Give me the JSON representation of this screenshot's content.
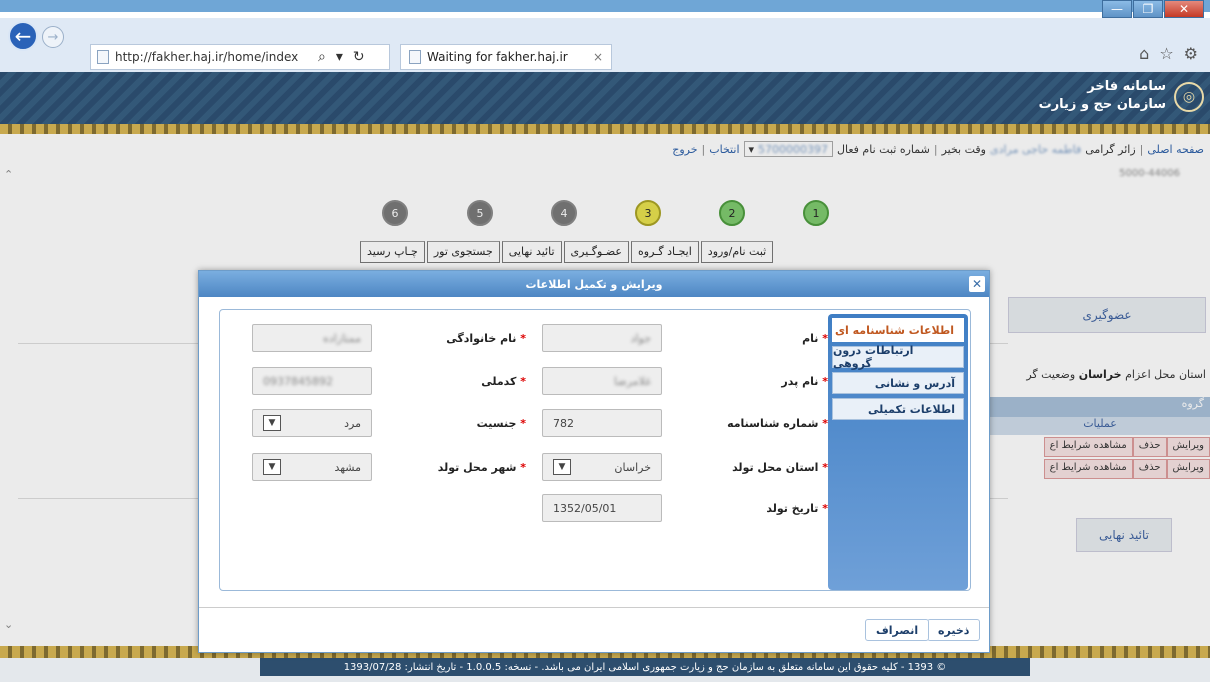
{
  "browser": {
    "url": "http://fakher.haj.ir/home/index",
    "tab_title": "Waiting for fakher.haj.ir",
    "win_min": "—",
    "win_max": "❐",
    "win_close": "✕"
  },
  "banner": {
    "brand_line1": "سامانه فاخر",
    "brand_line2": "سازمان حج و زیارت"
  },
  "userbar": {
    "home": "صفحه اصلی",
    "greeting_prefix": "زائر گرامی",
    "greeting_name": "فاطمه حاجی مرادی",
    "greeting_suffix": "وقت بخیر",
    "reg_label": "شماره ثبت نام فعال",
    "reg_number": "5700000397",
    "select": "انتخاب",
    "logout": "خروج",
    "subtitle": "5000-44006"
  },
  "steps": [
    {
      "num": "1",
      "label": "ثبت نام/ورود",
      "state": "done"
    },
    {
      "num": "2",
      "label": "ایجـاد گـروه",
      "state": "done"
    },
    {
      "num": "3",
      "label": "عضـوگـیری",
      "state": "current"
    },
    {
      "num": "4",
      "label": "تائید نهایی",
      "state": "pending"
    },
    {
      "num": "5",
      "label": "جستجوی تور",
      "state": "pending"
    },
    {
      "num": "6",
      "label": "چـاپ رسید",
      "state": "pending"
    }
  ],
  "right": {
    "membership_btn": "عضوگیری",
    "province_label": "استان محل اعزام",
    "province_value": "خراسان",
    "status_label": "وضعیت گر",
    "group_header": "گروه",
    "ops_header": "عملیات",
    "rows": [
      {
        "edit": "ویرایش",
        "delete": "حذف",
        "view": "مشاهده شرایط اع"
      },
      {
        "edit": "ویرایش",
        "delete": "حذف",
        "view": "مشاهده شرایط اع"
      }
    ],
    "final_btn": "تائید نهایی"
  },
  "modal": {
    "title": "ویرایش و تکمیل اطلاعات",
    "close": "✕",
    "tabs": [
      {
        "label": "اطلاعات شناسنامه ای",
        "active": true
      },
      {
        "label": "ارتباطات درون گروهی",
        "active": false
      },
      {
        "label": "آدرس و نشانی",
        "active": false
      },
      {
        "label": "اطلاعات تکمیلی",
        "active": false
      }
    ],
    "fields": {
      "first_name_label": "نام",
      "first_name_value": "جواد",
      "last_name_label": "نام خانوادگی",
      "last_name_value": "ممتازاده",
      "father_label": "نام پدر",
      "father_value": "غلامرضا",
      "national_label": "کدملی",
      "national_value": "0937845892",
      "cert_label": "شماره شناسنامه",
      "cert_value": "782",
      "gender_label": "جنسیت",
      "gender_value": "مرد",
      "birth_province_label": "استان محل تولد",
      "birth_province_value": "خراسان",
      "birth_city_label": "شهر محل تولد",
      "birth_city_value": "مشهد",
      "birth_date_label": "تاریخ تولد",
      "birth_date_value": "1352/05/01"
    },
    "save_btn": "ذخیره",
    "cancel_btn": "انصراف"
  },
  "footer": {
    "text": "© 1393 - کلیه حقوق این سامانه متعلق به سازمان حج و زیارت جمهوری اسلامی ایران می باشد. - نسخه: 1.0.0.5 - تاریخ انتشار: 1393/07/28"
  }
}
